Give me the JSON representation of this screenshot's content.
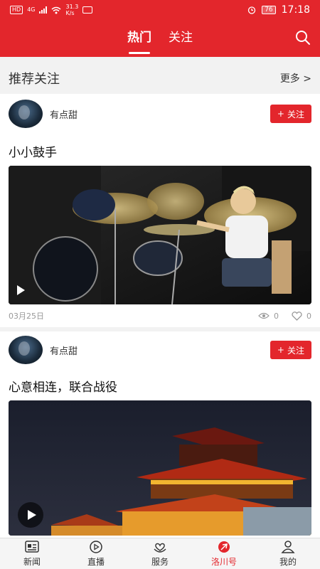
{
  "status": {
    "hd": "HD",
    "network": "4G",
    "speed_value": "31.3",
    "speed_unit": "K/s",
    "battery": "76",
    "time": "17:18"
  },
  "header": {
    "tabs": [
      {
        "label": "热门",
        "active": true
      },
      {
        "label": "关注",
        "active": false
      }
    ]
  },
  "section": {
    "title": "推荐关注",
    "more": "更多 >"
  },
  "posts": [
    {
      "author": "有点甜",
      "follow_label": "关注",
      "title": "小小鼓手",
      "date": "03月25日",
      "views": "0",
      "likes": "0"
    },
    {
      "author": "有点甜",
      "follow_label": "关注",
      "title": "心意相连，联合战役"
    }
  ],
  "nav": [
    {
      "label": "新闻",
      "icon": "news-icon",
      "active": false
    },
    {
      "label": "直播",
      "icon": "live-icon",
      "active": false
    },
    {
      "label": "服务",
      "icon": "service-icon",
      "active": false
    },
    {
      "label": "洛川号",
      "icon": "luochuan-icon",
      "active": true
    },
    {
      "label": "我的",
      "icon": "profile-icon",
      "active": false
    }
  ],
  "colors": {
    "accent": "#e3262c",
    "background": "#f2f2f2"
  }
}
